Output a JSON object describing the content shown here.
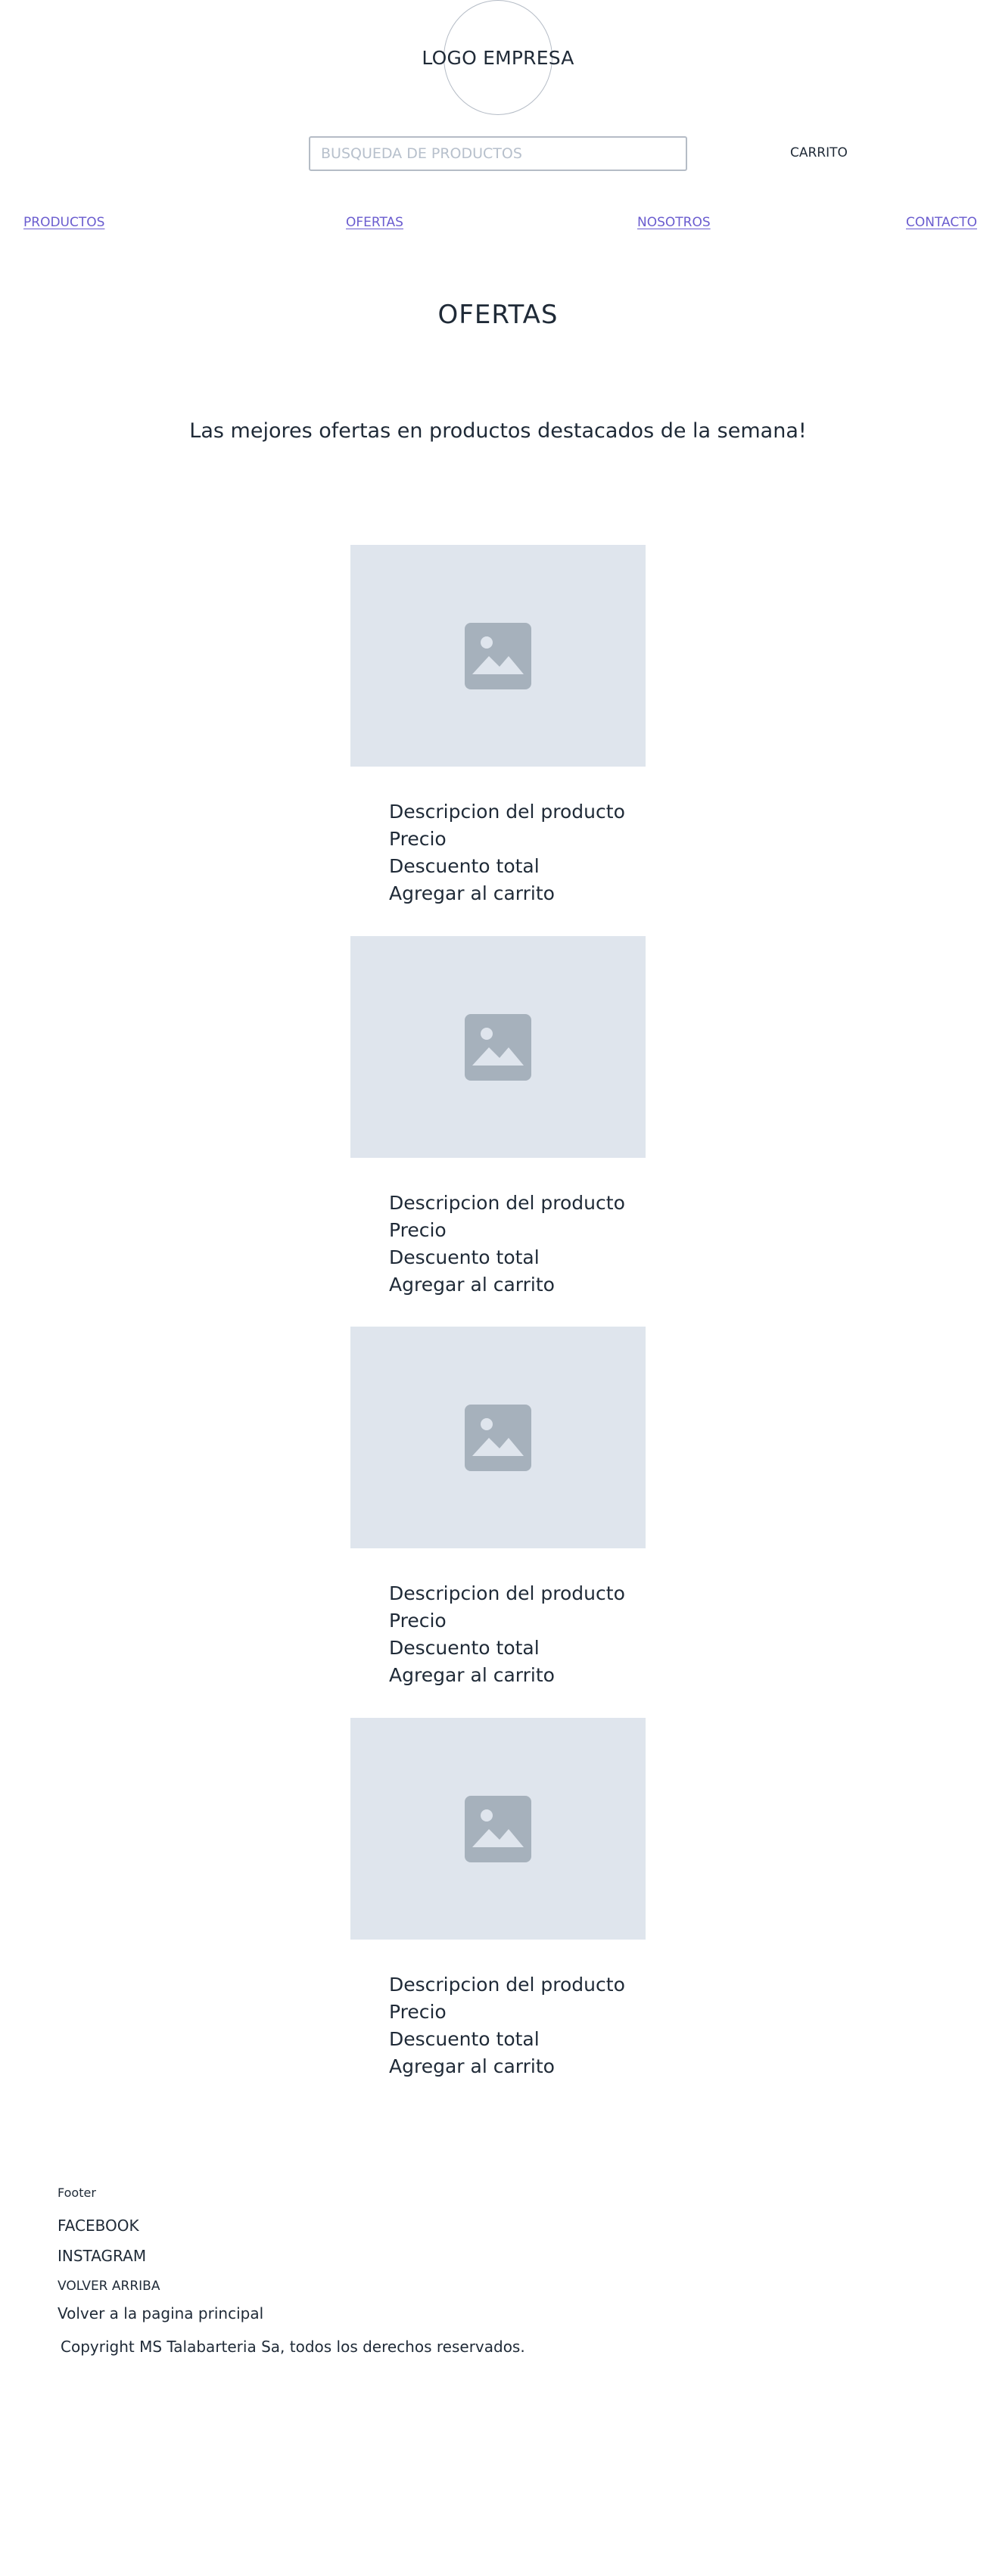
{
  "header": {
    "logo_text": "LOGO EMPRESA",
    "search_placeholder": "BUSQUEDA DE PRODUCTOS",
    "search_value": "",
    "cart_label": "CARRITO"
  },
  "nav": {
    "items": [
      {
        "label": "PRODUCTOS"
      },
      {
        "label": "OFERTAS"
      },
      {
        "label": "NOSOTROS"
      },
      {
        "label": "CONTACTO"
      }
    ]
  },
  "main": {
    "title": "OFERTAS",
    "subtitle": "Las mejores ofertas en productos destacados de la semana!",
    "products": [
      {
        "image_icon": "image-placeholder-icon",
        "description": "Descripcion del producto",
        "price": "Precio",
        "discount": "Descuento total",
        "add_to_cart": "Agregar al carrito"
      },
      {
        "image_icon": "image-placeholder-icon",
        "description": "Descripcion del producto",
        "price": "Precio",
        "discount": "Descuento total",
        "add_to_cart": "Agregar al carrito"
      },
      {
        "image_icon": "image-placeholder-icon",
        "description": "Descripcion del producto",
        "price": "Precio",
        "discount": "Descuento total",
        "add_to_cart": "Agregar al carrito"
      },
      {
        "image_icon": "image-placeholder-icon",
        "description": "Descripcion del producto",
        "price": "Precio",
        "discount": "Descuento total",
        "add_to_cart": "Agregar al carrito"
      }
    ]
  },
  "footer": {
    "label": "Footer",
    "links": [
      {
        "label": "FACEBOOK"
      },
      {
        "label": "INSTAGRAM"
      }
    ],
    "back_to_top": "VOLVER ARRIBA",
    "main_page_link": "Volver a la pagina principal",
    "copyright": "Copyright MS Talabarteria Sa, todos los derechos reservados."
  },
  "colors": {
    "text": "#1f2a37",
    "link": "#6a5ccf",
    "placeholder_bg": "#dfe5ed",
    "placeholder_icon": "#a6b1bc",
    "border": "#b5bcc6"
  }
}
